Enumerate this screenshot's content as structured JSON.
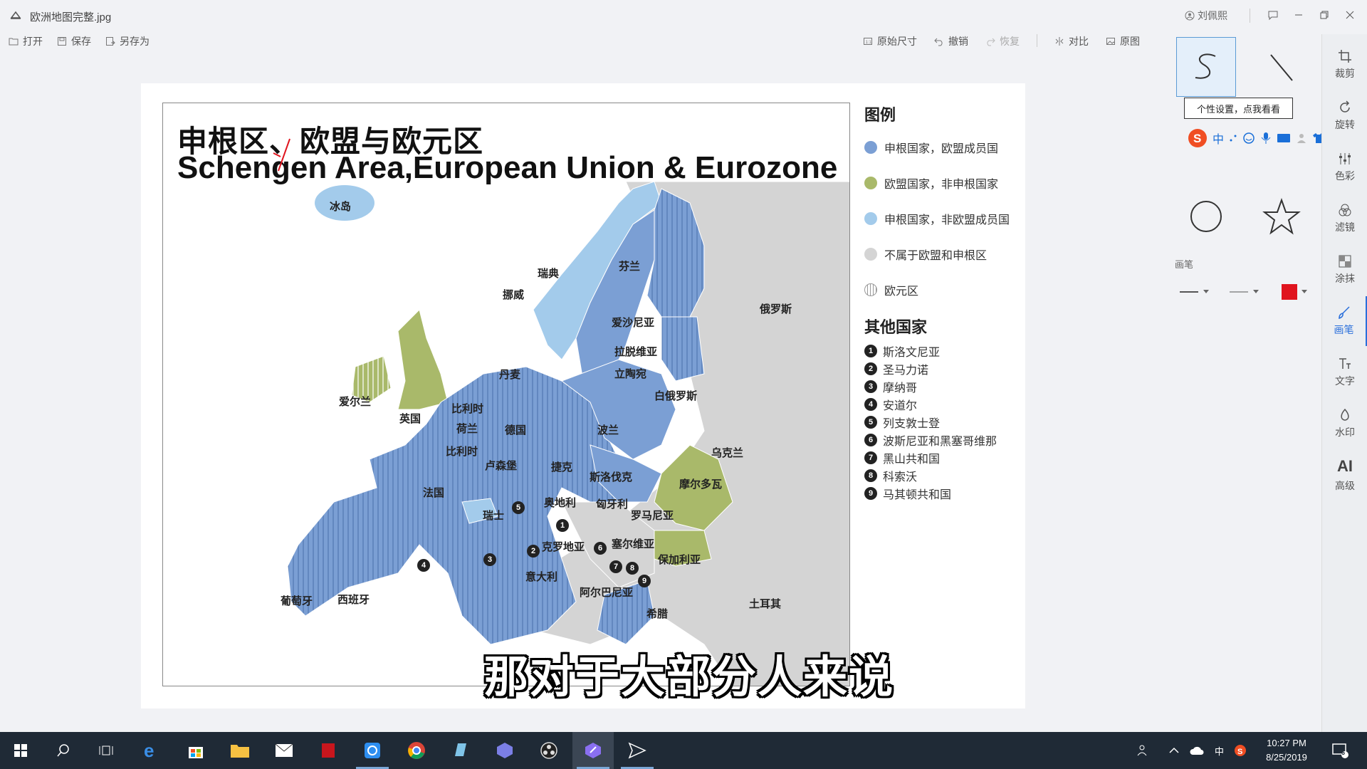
{
  "window": {
    "file_title": "欧洲地图完整.jpg",
    "user_name": "刘佩熙"
  },
  "toolbar": {
    "open": "打开",
    "save": "保存",
    "save_as": "另存为",
    "original_size": "原始尺寸",
    "undo": "撤销",
    "redo": "恢复",
    "compare": "对比",
    "original_image": "原图"
  },
  "map": {
    "title_cn": "申根区、欧盟与欧元区",
    "title_en": "Schengen Area,European Union & Eurozone",
    "countries": {
      "iceland": "冰岛",
      "finland": "芬兰",
      "sweden": "瑞典",
      "norway": "挪威",
      "russia": "俄罗斯",
      "estonia": "爱沙尼亚",
      "latvia": "拉脱维亚",
      "lithuania": "立陶宛",
      "denmark": "丹麦",
      "belarus": "白俄罗斯",
      "ireland": "爱尔兰",
      "uk": "英国",
      "belgium_top": "比利时",
      "netherlands": "荷兰",
      "germany": "德国",
      "poland": "波兰",
      "belgium": "比利时",
      "luxembourg": "卢森堡",
      "czech": "捷克",
      "ukraine": "乌克兰",
      "slovakia": "斯洛伐克",
      "moldova": "摩尔多瓦",
      "france": "法国",
      "austria": "奥地利",
      "hungary": "匈牙利",
      "switzerland": "瑞士",
      "romania": "罗马尼亚",
      "croatia": "克罗地亚",
      "serbia": "塞尔维亚",
      "bulgaria": "保加利亚",
      "italy": "意大利",
      "portugal": "葡萄牙",
      "spain": "西班牙",
      "albania": "阿尔巴尼亚",
      "turkey": "土耳其",
      "greece": "希腊"
    },
    "markers": [
      "5",
      "1",
      "2",
      "6",
      "3",
      "4",
      "7",
      "8",
      "9"
    ]
  },
  "legend": {
    "title": "图例",
    "items": [
      {
        "label": "申根国家，欧盟成员国",
        "color": "#7b9fd4"
      },
      {
        "label": "欧盟国家，非申根国家",
        "color": "#a9b96a"
      },
      {
        "label": "申根国家，非欧盟成员国",
        "color": "#a3cbeb"
      },
      {
        "label": "不属于欧盟和申根区",
        "color": "#d4d4d4"
      },
      {
        "label": "欧元区",
        "color": "striped"
      }
    ]
  },
  "others": {
    "title": "其他国家",
    "items": [
      {
        "num": "1",
        "label": "斯洛文尼亚"
      },
      {
        "num": "2",
        "label": "圣马力诺"
      },
      {
        "num": "3",
        "label": "摩纳哥"
      },
      {
        "num": "4",
        "label": "安道尔"
      },
      {
        "num": "5",
        "label": "列支敦士登"
      },
      {
        "num": "6",
        "label": "波斯尼亚和黑塞哥维那"
      },
      {
        "num": "7",
        "label": "黑山共和国"
      },
      {
        "num": "8",
        "label": "科索沃"
      },
      {
        "num": "9",
        "label": "马其顿共和国"
      }
    ]
  },
  "subtitle": "那对于大部分人来说",
  "shape_panel": {
    "tooltip": "个性设置，点我看看",
    "brush_label": "画笔",
    "brush_color": "#e0141e"
  },
  "sidebar": [
    {
      "label": "裁剪",
      "icon": "crop-icon"
    },
    {
      "label": "旋转",
      "icon": "rotate-icon"
    },
    {
      "label": "色彩",
      "icon": "adjust-icon"
    },
    {
      "label": "滤镜",
      "icon": "filter-icon"
    },
    {
      "label": "涂抹",
      "icon": "mosaic-icon"
    },
    {
      "label": "画笔",
      "icon": "brush-icon"
    },
    {
      "label": "文字",
      "icon": "text-icon"
    },
    {
      "label": "水印",
      "icon": "watermark-icon"
    },
    {
      "label": "高级",
      "icon": "ai-icon",
      "glyph": "AI"
    }
  ],
  "ime": {
    "mode": "中"
  },
  "taskbar": {
    "time": "10:27 PM",
    "date": "8/25/2019",
    "tray_lang": "中",
    "notifications": "6"
  }
}
